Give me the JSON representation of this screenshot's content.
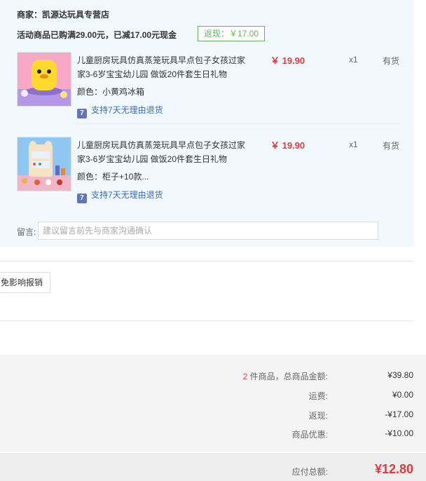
{
  "store": {
    "label": "商家：凯源达玩具专营店"
  },
  "promo": {
    "text": "活动商品已购满29.00元，已减17.00元现金",
    "tag": "返现：￥17.00"
  },
  "items": [
    {
      "title": "儿童厨房玩具仿真蒸笼玩具早点包子女孩过家家3-6岁宝宝幼儿园 做饭20件套生日礼物",
      "variant": "颜色：小黄鸡冰箱",
      "service": "支持7天无理由退货",
      "price": "￥ 19.90",
      "qty": "x1",
      "stock": "有货",
      "thumb_colors": {
        "bg": "#f6a8c6",
        "accent": "#ffd92e",
        "floor": "#b497e6"
      }
    },
    {
      "title": "儿童厨房玩具仿真蒸笼玩具早点包子女孩过家家3-6岁宝宝幼儿园 做饭20件套生日礼物",
      "variant": "颜色：柜子+10款...",
      "service": "支持7天无理由退货",
      "price": "￥ 19.90",
      "qty": "x1",
      "stock": "有货",
      "thumb_colors": {
        "bg": "#8fc7f2",
        "accent": "#f6e3c4",
        "floor": "#f2b5c8"
      }
    }
  ],
  "memo": {
    "label": "留言:",
    "placeholder": "建议留言前先与商家沟通确认"
  },
  "invoice": {
    "label": "免影响报销"
  },
  "summary": {
    "count": "2",
    "count_suffix": " 件商品，总商品金额:",
    "goods_total": "¥39.80",
    "shipping_label": "运费:",
    "shipping": "¥0.00",
    "cashback_label": "返现:",
    "cashback": "-¥17.00",
    "discount_label": "商品优惠:",
    "discount": "-¥10.00",
    "payable_label": "应付总额:",
    "payable": "¥12.80"
  }
}
